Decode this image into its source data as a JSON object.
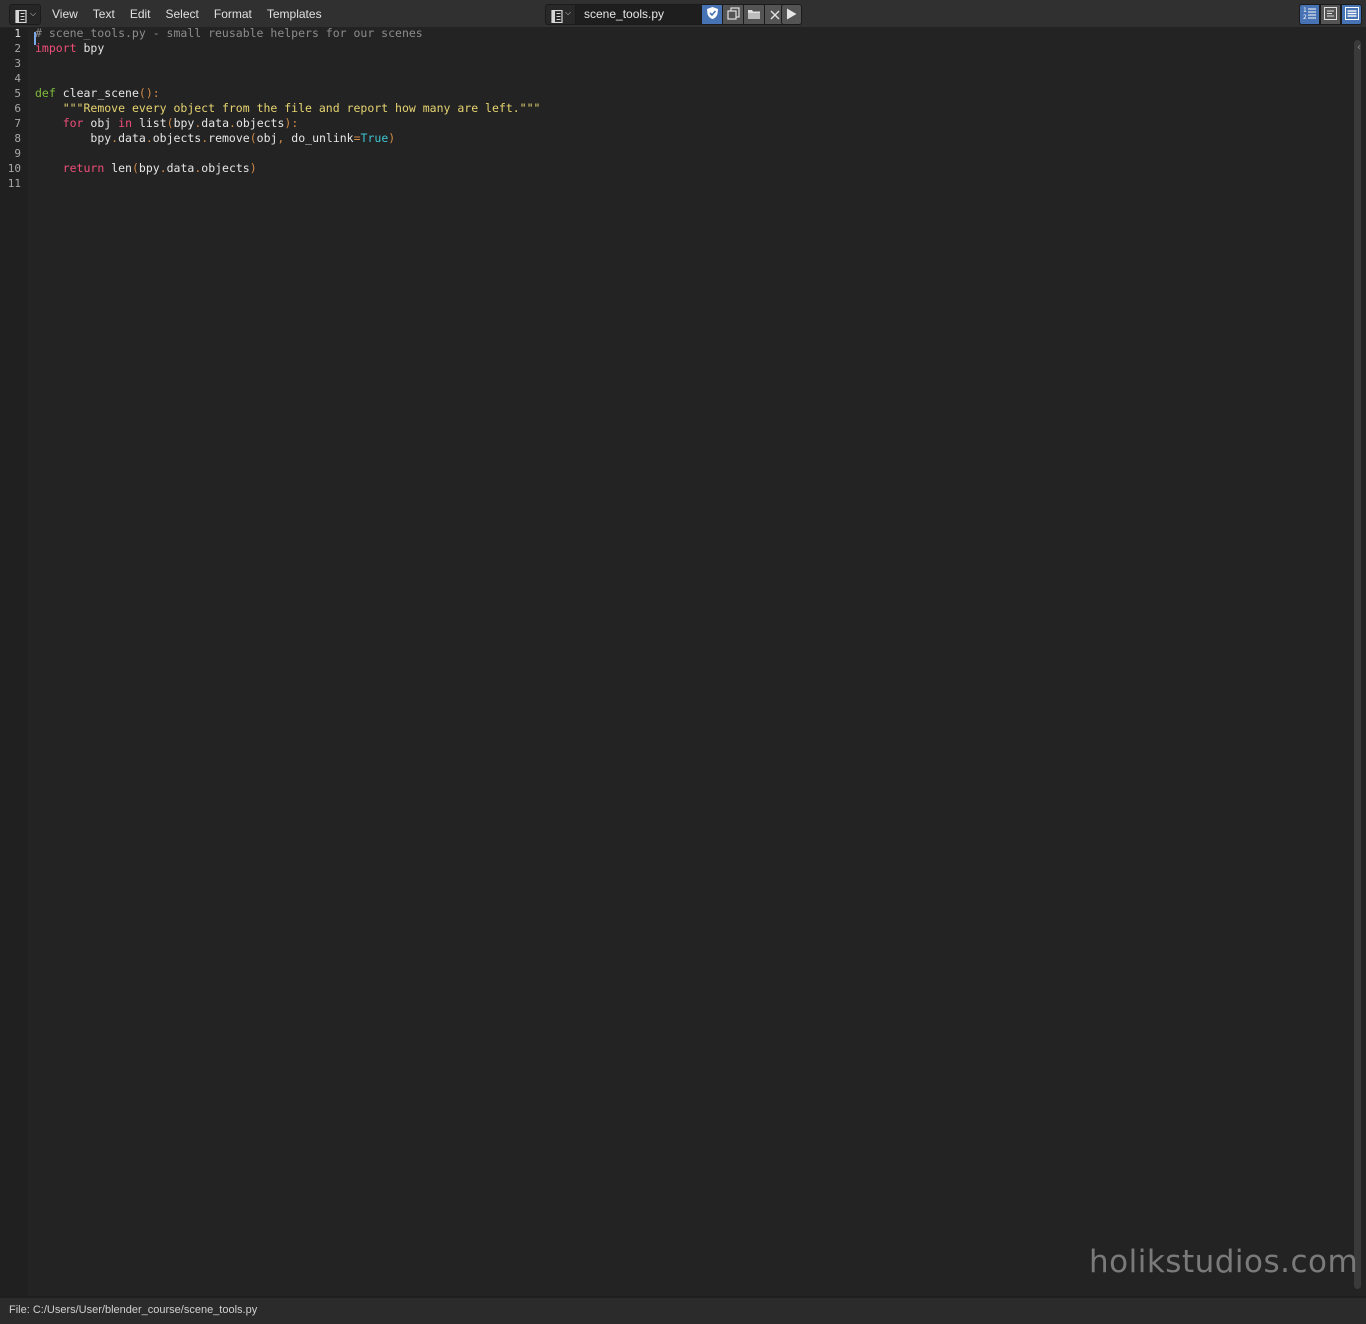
{
  "header": {
    "menu": [
      "View",
      "Text",
      "Edit",
      "Select",
      "Format",
      "Templates"
    ],
    "text_name": "scene_tools.py"
  },
  "editor": {
    "line_numbers": [
      "1",
      "2",
      "3",
      "4",
      "5",
      "6",
      "7",
      "8",
      "9",
      "10",
      "11"
    ],
    "lines": [
      "# scene_tools.py - small reusable helpers for our scenes",
      "import bpy",
      "",
      "",
      "def clear_scene():",
      "    \"\"\"Remove every object from the file and report how many are left.\"\"\"",
      "    for obj in list(bpy.data.objects):",
      "        bpy.data.objects.remove(obj, do_unlink=True)",
      "",
      "    return len(bpy.data.objects)",
      ""
    ],
    "current_line": 1
  },
  "watermark": "holikstudios.com",
  "status": {
    "file_path": "File: C:/Users/User/blender_course/scene_tools.py"
  },
  "colors": {
    "comment": "#8c8c8c",
    "keyword": "#ee4e78",
    "def_keyword": "#7fbb3d",
    "string": "#e6d471",
    "punctuation": "#d08a46",
    "bool": "#3fc4d1",
    "accent": "#4772b3"
  },
  "icons": {
    "editor_type": "text-editor-icon",
    "browse": "text-datablock-icon",
    "fake_user": "shield-fake-user-icon",
    "new_text": "new-text-icon",
    "open_text": "folder-open-icon",
    "unlink": "close-x-icon",
    "run": "play-run-script-icon",
    "toggles": [
      "line-numbers-icon",
      "word-wrap-icon",
      "syntax-highlight-icon"
    ]
  }
}
